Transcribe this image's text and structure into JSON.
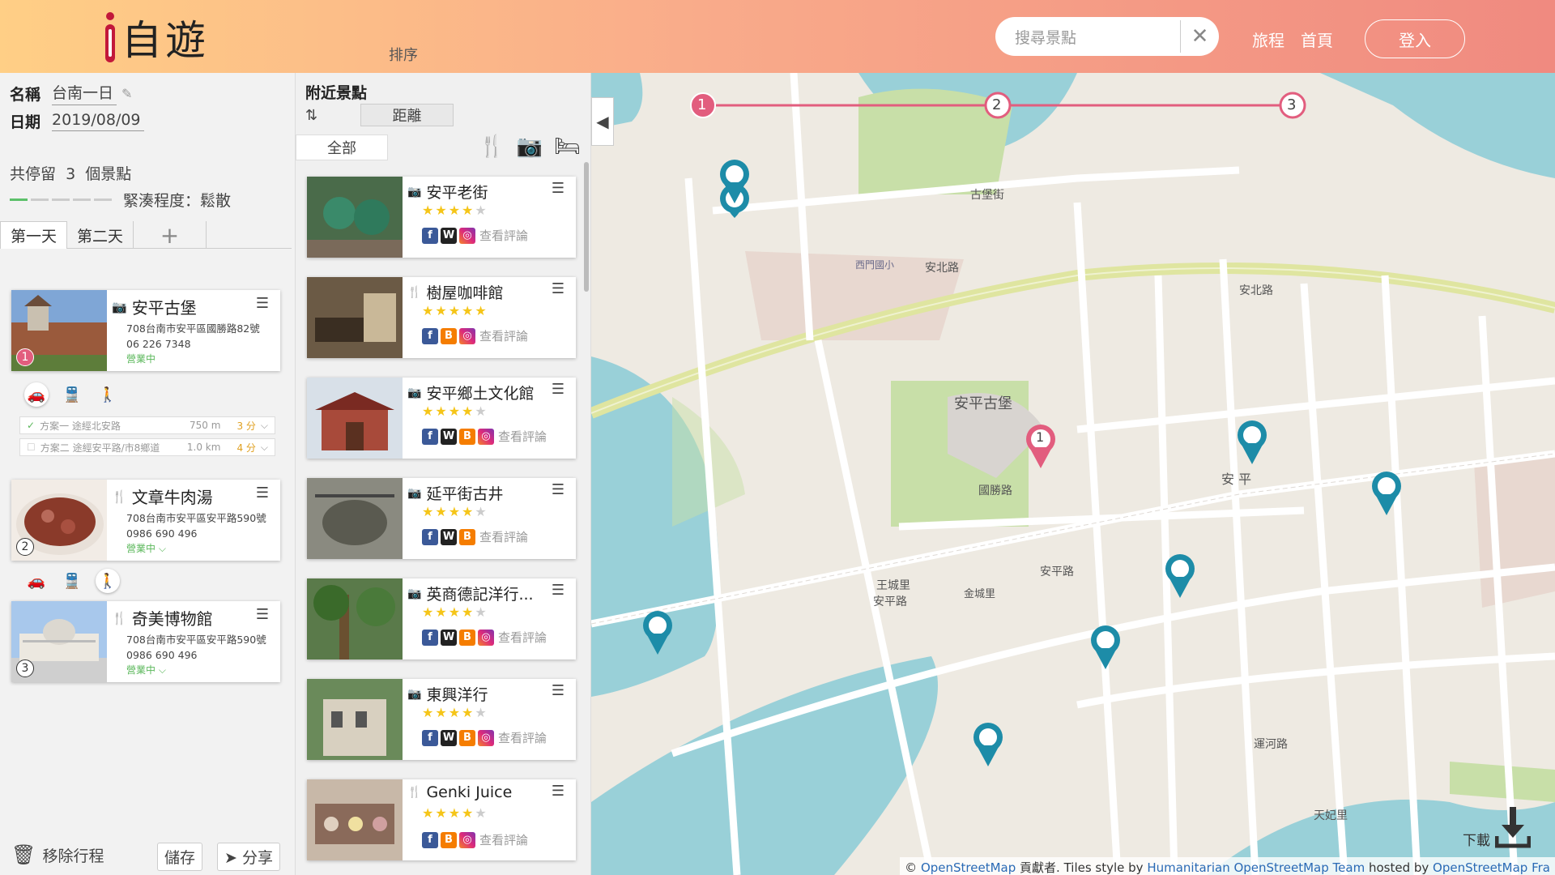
{
  "header": {
    "logo_text": "自遊",
    "sort_label": "排序",
    "search_placeholder": "搜尋景點",
    "nav": [
      "旅程",
      "首頁"
    ],
    "login": "登入"
  },
  "trip": {
    "name_label": "名稱",
    "name_value": "台南一日",
    "date_label": "日期",
    "date_value": "2019/08/09",
    "stops_prefix": "共停留",
    "stops_count": "3",
    "stops_suffix": "個景點",
    "tightness": "緊湊程度：鬆散",
    "tightness_level": 1,
    "tabs": [
      "第一天",
      "第二天"
    ],
    "add_tab": "+"
  },
  "itinerary": [
    {
      "name": "安平古堡",
      "type_icon": "camera-icon",
      "address": "708台南市安平區國勝路82號",
      "phone": "06 226 7348",
      "status": "營業中",
      "order": "1"
    },
    {
      "name": "文章牛肉湯",
      "type_icon": "cutlery-icon",
      "address": "708台南市安平區安平路590號",
      "phone": "0986 690 496",
      "status": "營業中",
      "order": "2"
    },
    {
      "name": "奇美博物館",
      "type_icon": "cutlery-icon",
      "address": "708台南市安平區安平路590號",
      "phone": "0986 690 496",
      "status": "營業中",
      "order": "3"
    }
  ],
  "routes": [
    {
      "label": "方案一  途經北安路",
      "dist": "750 m",
      "time": "3 分"
    },
    {
      "label": "方案二  途經安平路/市8鄉道",
      "dist": "1.0 km",
      "time": "4 分"
    }
  ],
  "footer": {
    "remove": "移除行程",
    "save": "儲存",
    "share": "分享"
  },
  "nearby": {
    "title": "附近景點",
    "sort_by": "距離",
    "filter_all": "全部",
    "review_text": "查看評論",
    "places": [
      {
        "name": "安平老街",
        "icon": "camera-icon",
        "stars": 4,
        "social": [
          "fb",
          "wiki",
          "ig"
        ]
      },
      {
        "name": "樹屋咖啡館",
        "icon": "cutlery-icon",
        "stars": 5,
        "social": [
          "fb",
          "blog",
          "ig"
        ]
      },
      {
        "name": "安平鄉土文化館",
        "icon": "camera-icon",
        "stars": 4,
        "social": [
          "fb",
          "wiki",
          "blog",
          "ig"
        ]
      },
      {
        "name": "延平街古井",
        "icon": "camera-icon",
        "stars": 4,
        "social": [
          "fb",
          "wiki",
          "blog"
        ]
      },
      {
        "name": "英商德記洋行...",
        "icon": "camera-icon",
        "stars": 4,
        "social": [
          "fb",
          "wiki",
          "blog",
          "ig"
        ]
      },
      {
        "name": "東興洋行",
        "icon": "camera-icon",
        "stars": 4,
        "social": [
          "fb",
          "wiki",
          "blog",
          "ig"
        ]
      },
      {
        "name": "Genki Juice",
        "icon": "cutlery-icon",
        "stars": 4,
        "social": [
          "fb",
          "blog",
          "ig"
        ]
      }
    ]
  },
  "map": {
    "route_stops": [
      "1",
      "2",
      "3"
    ],
    "labels": {
      "anping_fort": "安平古堡",
      "anbei_rd": "安北路",
      "anping_rd": "安平路",
      "guosheng_rd": "國勝路",
      "guobao_st": "古堡街",
      "wangcheng": "王城里",
      "anping": "安 平",
      "yunhe": "運河路",
      "tianfei": "天妃里",
      "jincheng": "金城里",
      "ximen": "西門國小"
    },
    "download": "下載",
    "attribution_prefix": "© ",
    "attribution_osm": "OpenStreetMap",
    "attribution_contrib": " 貢獻者. Tiles style by ",
    "attribution_hot": "Humanitarian OpenStreetMap Team",
    "attribution_host": " hosted by ",
    "attribution_osmfr": "OpenStreetMap Fra"
  }
}
